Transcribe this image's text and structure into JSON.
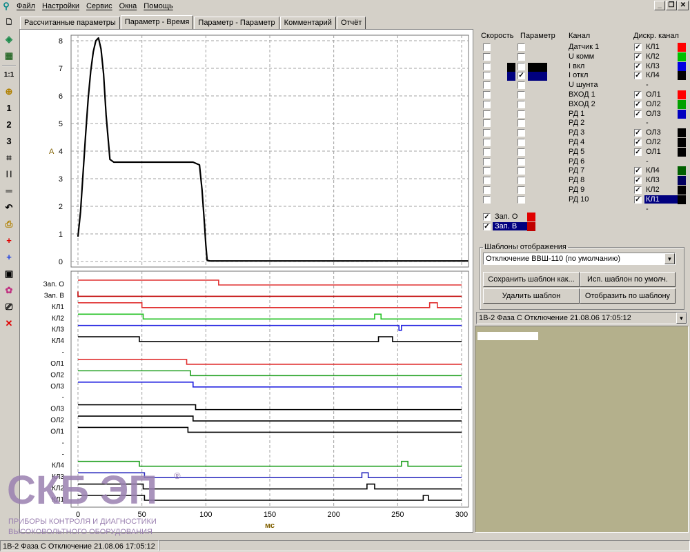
{
  "menubar": {
    "items": [
      "Файл",
      "Настройки",
      "Сервис",
      "Окна",
      "Помощь"
    ],
    "window_buttons": [
      "_",
      "❐",
      "✕"
    ]
  },
  "toolbar": {
    "tools": [
      {
        "name": "new-file-icon",
        "glyph": "🗋",
        "color": "#000000"
      },
      {
        "name": "open-icon",
        "glyph": "◈",
        "color": "#1a8a4a"
      },
      {
        "name": "grid-icon",
        "glyph": "▦",
        "color": "#2a6a2a"
      },
      {
        "sep": true
      },
      {
        "name": "ratio-icon",
        "glyph": "1:1",
        "color": "#000000"
      },
      {
        "name": "zoom-icon",
        "glyph": "⊕",
        "color": "#b08000"
      },
      {
        "name": "one-icon",
        "glyph": "1",
        "color": "#000000"
      },
      {
        "name": "two-icon",
        "glyph": "2",
        "color": "#000000"
      },
      {
        "name": "three-icon",
        "glyph": "3",
        "color": "#000000"
      },
      {
        "name": "crop-icon",
        "glyph": "⌗",
        "color": "#000000"
      },
      {
        "name": "vertical-cursors-icon",
        "glyph": "| |",
        "color": "#000000"
      },
      {
        "name": "horizontal-cursors-icon",
        "glyph": "═",
        "color": "#000000"
      },
      {
        "name": "undo-icon",
        "glyph": "↶",
        "color": "#000000"
      },
      {
        "name": "print-icon",
        "glyph": "⎙",
        "color": "#b08000"
      },
      {
        "name": "red-cross-icon",
        "glyph": "+",
        "color": "#e00000"
      },
      {
        "name": "blue-cross-icon",
        "glyph": "+",
        "color": "#2040e0"
      },
      {
        "name": "frame-icon",
        "glyph": "▣",
        "color": "#000000"
      },
      {
        "name": "colors-icon",
        "glyph": "✿",
        "color": "#c03080"
      },
      {
        "name": "printer-icon",
        "glyph": "⎚",
        "color": "#000000"
      },
      {
        "name": "close-icon",
        "glyph": "✕",
        "color": "#e00000"
      }
    ]
  },
  "tabs": [
    {
      "label": "Рассчитанные параметры",
      "active": false
    },
    {
      "label": "Параметр - Время",
      "active": true
    },
    {
      "label": "Параметр - Параметр",
      "active": false
    },
    {
      "label": "Комментарий",
      "active": false
    },
    {
      "label": "Отчёт",
      "active": false
    }
  ],
  "chart_data": [
    {
      "type": "line",
      "ylabel": "A",
      "ylim": [
        0,
        8
      ],
      "yticks": [
        0,
        1,
        2,
        3,
        4,
        5,
        6,
        7,
        8
      ],
      "xlim": [
        0,
        300
      ],
      "grid": true,
      "series": [
        {
          "color": "#000000",
          "x": [
            0,
            2,
            4,
            6,
            8,
            10,
            12,
            14,
            16,
            18,
            20,
            22,
            25,
            28,
            40,
            60,
            80,
            90,
            95,
            97,
            99,
            100,
            101,
            103,
            110,
            130,
            150,
            170,
            190,
            210,
            230,
            250,
            270,
            290,
            305
          ],
          "y": [
            0.9,
            1.8,
            3.2,
            4.6,
            5.9,
            6.9,
            7.6,
            8.0,
            8.1,
            7.7,
            6.8,
            5.3,
            3.7,
            3.6,
            3.6,
            3.6,
            3.6,
            3.6,
            3.5,
            2.6,
            1.3,
            0.6,
            0.05,
            0.02,
            0.02,
            0.02,
            0.02,
            0.02,
            0.02,
            0.02,
            0.02,
            0.02,
            0.02,
            0.02,
            0.02
          ]
        }
      ]
    },
    {
      "type": "line",
      "subtype": "digital-steps",
      "xlabel": "мс",
      "xlim": [
        0,
        300
      ],
      "xticks": [
        0,
        50,
        100,
        150,
        200,
        250,
        300
      ],
      "grid": true,
      "channels": [
        {
          "label": "Зап. О",
          "color": "#e03030",
          "steps": [
            0,
            110
          ]
        },
        {
          "label": "Зап. В",
          "color": "#c00000",
          "steps": [
            0,
            0
          ]
        },
        {
          "label": "КЛ1",
          "color": "#e03030",
          "steps": [
            0,
            50,
            275,
            281
          ]
        },
        {
          "label": "КЛ2",
          "color": "#20c020",
          "steps": [
            0,
            51,
            232,
            237
          ]
        },
        {
          "label": "КЛ3",
          "color": "#2020e0",
          "steps": [
            0,
            251,
            253
          ]
        },
        {
          "label": "КЛ4",
          "color": "#000000",
          "steps": [
            0,
            48,
            235,
            246
          ]
        },
        {
          "label": "-",
          "color": "#000000",
          "steps": null
        },
        {
          "label": "ОЛ1",
          "color": "#e03030",
          "steps": [
            0,
            85
          ]
        },
        {
          "label": "ОЛ2",
          "color": "#20a020",
          "steps": [
            0,
            88
          ]
        },
        {
          "label": "ОЛ3",
          "color": "#2020e0",
          "steps": [
            0,
            90
          ]
        },
        {
          "label": "-",
          "color": "#000000",
          "steps": null
        },
        {
          "label": "ОЛ3",
          "color": "#000000",
          "steps": [
            0,
            92
          ]
        },
        {
          "label": "ОЛ2",
          "color": "#000000",
          "steps": [
            0,
            90
          ]
        },
        {
          "label": "ОЛ1",
          "color": "#000000",
          "steps": [
            0,
            86
          ]
        },
        {
          "label": "-",
          "color": "#000000",
          "steps": null
        },
        {
          "label": "-",
          "color": "#000000",
          "steps": null
        },
        {
          "label": "КЛ4",
          "color": "#20a020",
          "steps": [
            0,
            48,
            253,
            258
          ]
        },
        {
          "label": "КЛ3",
          "color": "#3030c0",
          "steps": [
            0,
            52,
            222,
            227
          ]
        },
        {
          "label": "КЛ2",
          "color": "#000000",
          "steps": [
            0,
            51,
            226,
            232
          ]
        },
        {
          "label": "КЛ1",
          "color": "#000000",
          "steps": [
            0,
            52,
            270,
            274
          ]
        }
      ]
    }
  ],
  "right_panel": {
    "headers": {
      "speed": "Скорость",
      "param": "Параметр",
      "channel": "Канал",
      "discrete": "Дискр. канал"
    },
    "analog_channels": [
      {
        "label": "Датчик 1",
        "speed": false,
        "param": false,
        "swatch": null
      },
      {
        "label": "U комм",
        "speed": false,
        "param": false,
        "swatch": null
      },
      {
        "label": "I вкл",
        "speed": false,
        "param": false,
        "swatch": "#000000"
      },
      {
        "label": "I откл",
        "speed": false,
        "param": true,
        "swatch": "#00007f"
      },
      {
        "label": "U шунта",
        "speed": false,
        "param": false,
        "swatch": null
      },
      {
        "label": "ВХОД 1",
        "speed": false,
        "param": false,
        "swatch": null
      },
      {
        "label": "ВХОД 2",
        "speed": false,
        "param": false,
        "swatch": null
      },
      {
        "label": "РД 1",
        "speed": false,
        "param": false,
        "swatch": null
      },
      {
        "label": "РД 2",
        "speed": false,
        "param": false,
        "swatch": null
      },
      {
        "label": "РД 3",
        "speed": false,
        "param": false,
        "swatch": null
      },
      {
        "label": "РД 4",
        "speed": false,
        "param": false,
        "swatch": null
      },
      {
        "label": "РД 5",
        "speed": false,
        "param": false,
        "swatch": null
      },
      {
        "label": "РД 6",
        "speed": false,
        "param": false,
        "swatch": null
      },
      {
        "label": "РД 7",
        "speed": false,
        "param": false,
        "swatch": null
      },
      {
        "label": "РД 8",
        "speed": false,
        "param": false,
        "swatch": null
      },
      {
        "label": "РД 9",
        "speed": false,
        "param": false,
        "swatch": null
      },
      {
        "label": "РД 10",
        "speed": false,
        "param": false,
        "swatch": null
      }
    ],
    "zap": [
      {
        "label": "Зап. О",
        "checked": true,
        "color": "#e00000",
        "selected": false
      },
      {
        "label": "Зап. В",
        "checked": true,
        "color": "#c00000",
        "selected": true
      }
    ],
    "discrete_channels": [
      {
        "label": "КЛ1",
        "checked": true,
        "color": "#ff0000"
      },
      {
        "label": "КЛ2",
        "checked": true,
        "color": "#00c000"
      },
      {
        "label": "КЛ3",
        "checked": true,
        "color": "#0000e0"
      },
      {
        "label": "КЛ4",
        "checked": true,
        "color": "#000000"
      },
      {
        "label": "-",
        "checked": false,
        "color": null
      },
      {
        "label": "ОЛ1",
        "checked": true,
        "color": "#ff0000"
      },
      {
        "label": "ОЛ2",
        "checked": true,
        "color": "#00a000"
      },
      {
        "label": "ОЛ3",
        "checked": true,
        "color": "#0000c0"
      },
      {
        "label": "-",
        "checked": false,
        "color": null
      },
      {
        "label": "ОЛ3",
        "checked": true,
        "color": "#000000"
      },
      {
        "label": "ОЛ2",
        "checked": true,
        "color": "#000000"
      },
      {
        "label": "ОЛ1",
        "checked": true,
        "color": "#000000"
      },
      {
        "label": "-",
        "checked": false,
        "color": null
      },
      {
        "label": "КЛ4",
        "checked": true,
        "color": "#006000"
      },
      {
        "label": "КЛ3",
        "checked": true,
        "color": "#000060"
      },
      {
        "label": "КЛ2",
        "checked": true,
        "color": "#000000"
      },
      {
        "label": "КЛ1",
        "checked": true,
        "color": "#000000",
        "selected": true
      },
      {
        "label": "-",
        "checked": false,
        "color": null
      }
    ],
    "templates": {
      "legend": "Шаблоны отображения",
      "selected": "Отключение ВВШ-110 (по умолчанию)",
      "buttons": {
        "save": "Сохранить шаблон как...",
        "use_default": "Исп. шаблон по умолч.",
        "delete": "Удалить шаблон",
        "apply": "Отобразить по шаблону"
      }
    },
    "record_select": "1В-2 Фаза С Отключение 21.08.06 17:05:12"
  },
  "statusbar": {
    "text": "1В-2 Фаза С Отключение 21.08.06 17:05:12"
  },
  "logo": {
    "mark": "СКБ ЭП",
    "registered": "®",
    "line1": "ПРИБОРЫ КОНТРОЛЯ И ДИАГНОСТИКИ",
    "line2": "ВЫСОКОВОЛЬТНОГО ОБОРУДОВАНИЯ"
  },
  "colors": {
    "window_bg": "#d4d0c8",
    "selection": "#00007f",
    "grid": "#a0a0a0",
    "list_bg": "#b4b08c",
    "logo": "#9a80b0"
  }
}
